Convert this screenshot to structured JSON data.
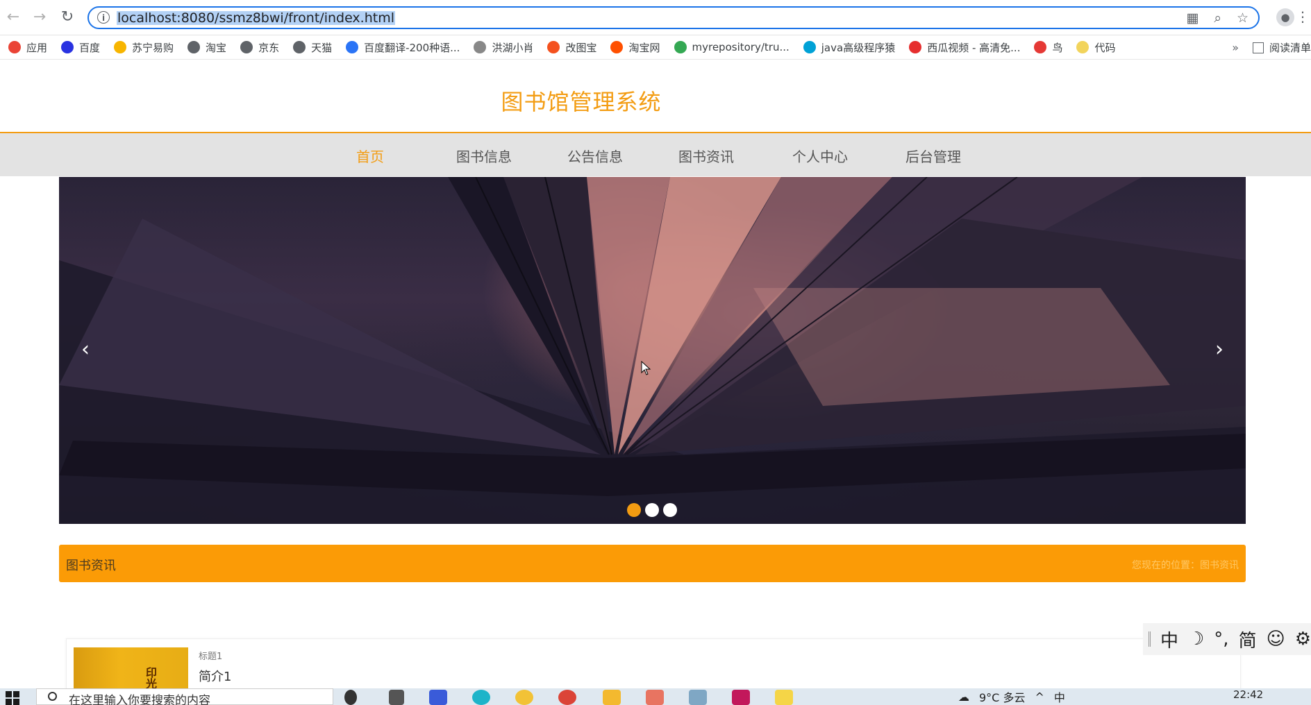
{
  "browser": {
    "url": "localhost:8080/ssmz8bwi/front/index.html",
    "bookmarks": [
      {
        "label": "应用",
        "icon": "apps-grid-icon",
        "color": "#ea4335"
      },
      {
        "label": "百度",
        "icon": "baidu-icon",
        "color": "#2932e1"
      },
      {
        "label": "苏宁易购",
        "icon": "suning-icon",
        "color": "#f7b500"
      },
      {
        "label": "淘宝",
        "icon": "globe-icon",
        "color": "#5f6368"
      },
      {
        "label": "京东",
        "icon": "globe-icon",
        "color": "#5f6368"
      },
      {
        "label": "天猫",
        "icon": "globe-icon",
        "color": "#5f6368"
      },
      {
        "label": "百度翻译-200种语...",
        "icon": "translate-icon",
        "color": "#2a74f6"
      },
      {
        "label": "洪湖小肖",
        "icon": "feather-icon",
        "color": "#888888"
      },
      {
        "label": "改图宝",
        "icon": "image-tool-icon",
        "color": "#f4511e"
      },
      {
        "label": "淘宝网",
        "icon": "taobao-icon",
        "color": "#ff5000"
      },
      {
        "label": "myrepository/tru...",
        "icon": "repo-icon",
        "color": "#34a853"
      },
      {
        "label": "java高级程序猿",
        "icon": "bilibili-icon",
        "color": "#00a1d6"
      },
      {
        "label": "西瓜视频 - 高清免...",
        "icon": "xigua-icon",
        "color": "#e62e2e"
      },
      {
        "label": "鸟",
        "icon": "bird-icon",
        "color": "#e53935"
      },
      {
        "label": "代码",
        "icon": "code-icon",
        "color": "#f2d45c"
      }
    ],
    "more_label": "»",
    "reader_label": "阅读清单"
  },
  "site": {
    "title": "图书馆管理系统",
    "nav": [
      {
        "label": "首页",
        "active": true
      },
      {
        "label": "图书信息",
        "active": false
      },
      {
        "label": "公告信息",
        "active": false
      },
      {
        "label": "图书资讯",
        "active": false
      },
      {
        "label": "个人中心",
        "active": false
      },
      {
        "label": "后台管理",
        "active": false
      }
    ],
    "carousel": {
      "slides": 3,
      "active_index": 0
    },
    "section": {
      "title": "图书资讯",
      "breadcrumb": "您现在的位置：图书资讯"
    },
    "card": {
      "label": "标题1",
      "summary": "简介1",
      "book_text": "印光大"
    }
  },
  "ime": {
    "items": [
      "中",
      "☽",
      "°,",
      "简",
      "☺",
      "⚙"
    ]
  },
  "taskbar": {
    "search_placeholder": "在这里输入你要搜索的内容",
    "tray_temp": "9°C 多云",
    "tray_lang": "中",
    "clock": "22:42"
  },
  "colors": {
    "accent": "#f39c12",
    "section_bar": "#fb9b06",
    "nav_bg": "#e3e3e3"
  }
}
